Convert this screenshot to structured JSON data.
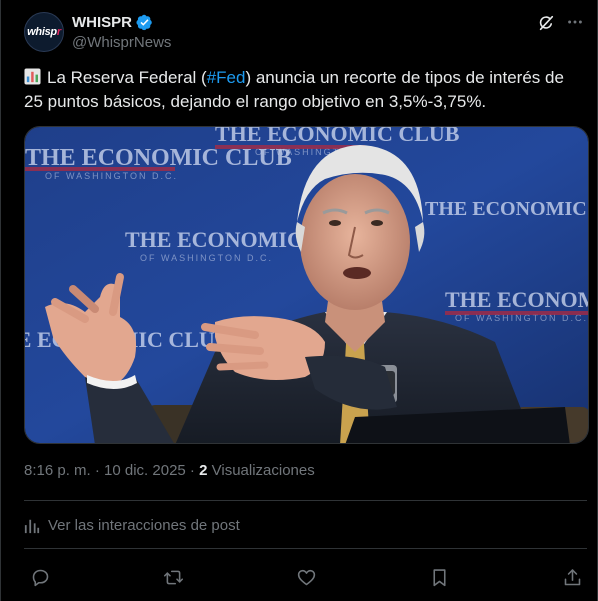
{
  "account": {
    "name": "WHISPR",
    "handle": "@WhisprNews",
    "avatar_logo_main": "whisp",
    "avatar_logo_accent": "r",
    "avatar_logo_sub": "NEWS"
  },
  "post": {
    "text_before": "La Reserva Federal (",
    "hashtag": "#Fed",
    "text_after": ") anuncia un recorte de tipos de interés de 25 puntos básicos, dejando el rango objetivo en 3,5%-3,75%.",
    "emoji": "bar-chart-icon",
    "media_backdrop_text": "THE ECONOMIC CLUB",
    "media_backdrop_subtext": "OF WASHINGTON D.C."
  },
  "meta": {
    "timestamp": "8:16 p. m. · 10 dic. 2025",
    "separator": " · ",
    "views_count": "2",
    "views_label": "Visualizaciones"
  },
  "interactions_label": "Ver las interacciones de post",
  "actions": [
    "reply-icon",
    "repost-icon",
    "like-icon",
    "bookmark-icon",
    "share-icon"
  ],
  "colors": {
    "background": "#000000",
    "text": "#e7e9ea",
    "secondary": "#71767b",
    "accent": "#1d9bf0",
    "divider": "#2f3336"
  }
}
